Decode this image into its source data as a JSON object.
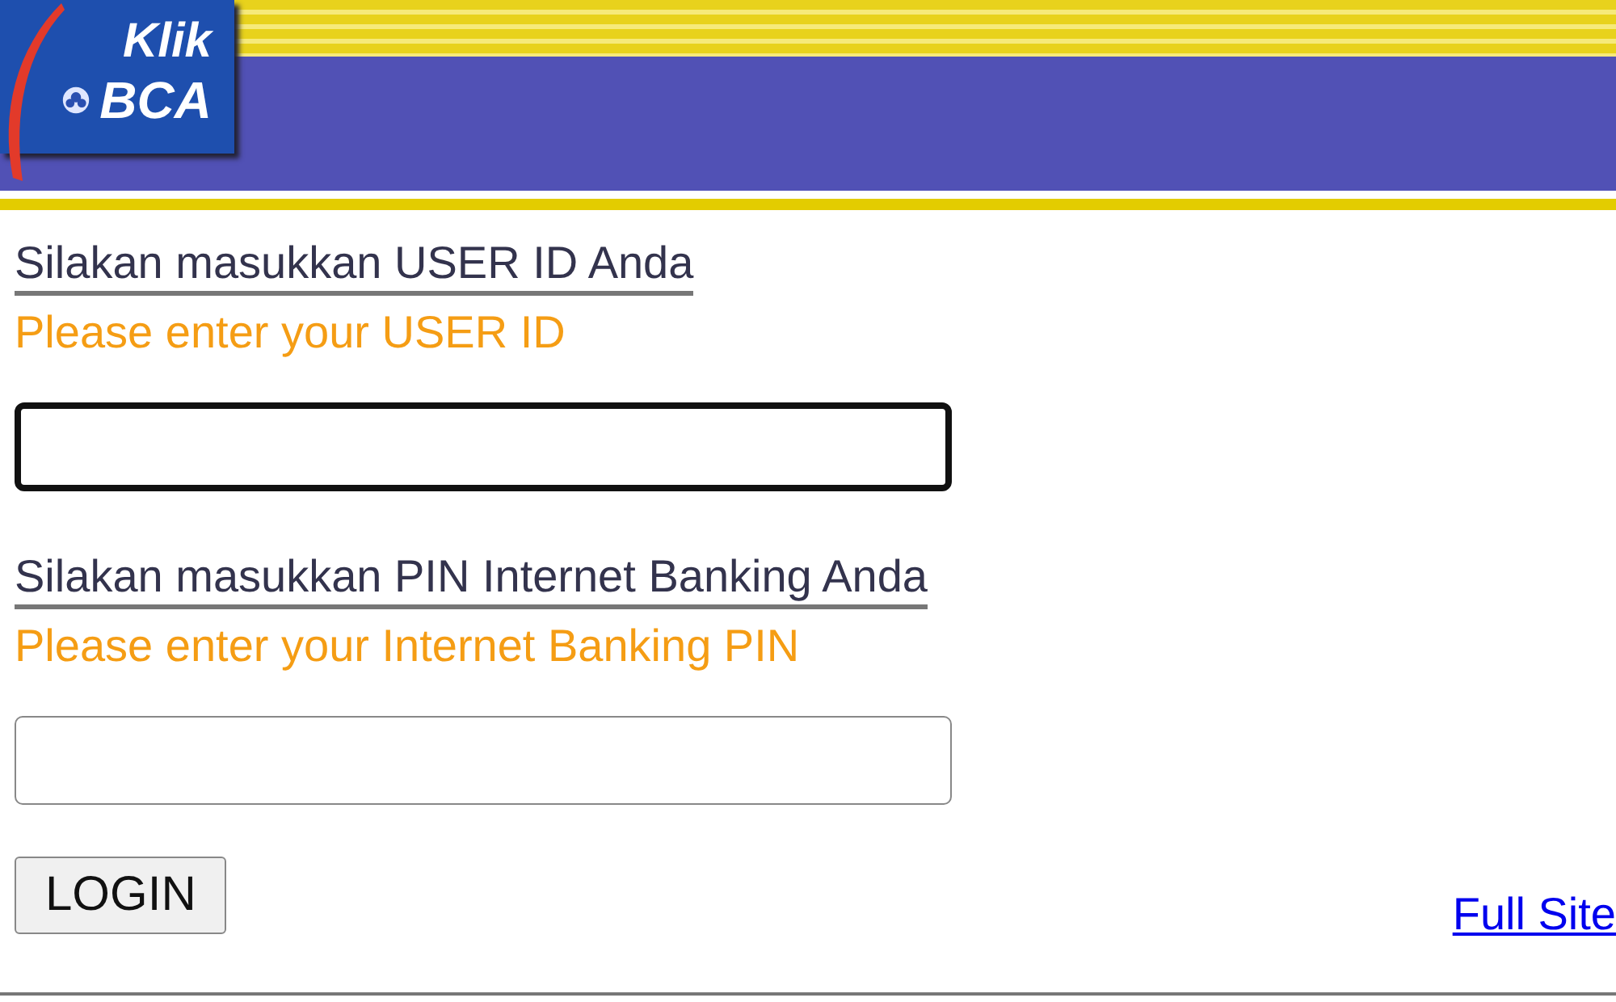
{
  "logo": {
    "line_1": "Klik",
    "line_2": "BCA"
  },
  "fields": [
    {
      "label": "Silakan masukkan USER ID Anda",
      "hint": "Please enter your USER ID",
      "focused": true
    },
    {
      "label": "Silakan masukkan PIN Internet Banking Anda",
      "hint": "Please enter your Internet Banking PIN",
      "focused": false
    }
  ],
  "login_button": "LOGIN",
  "full_site_link": "Full Site"
}
